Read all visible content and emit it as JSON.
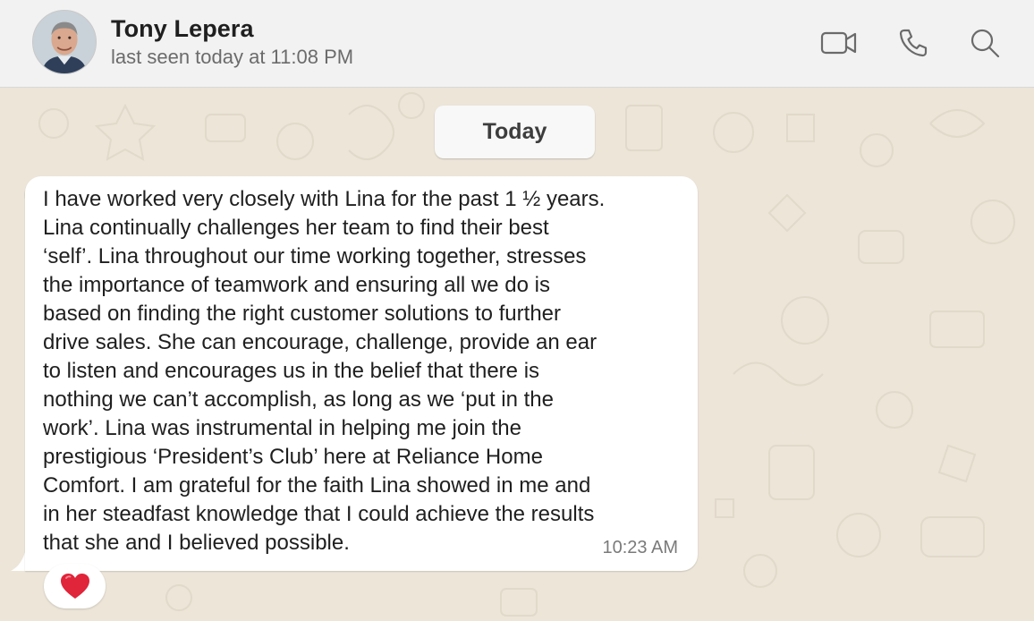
{
  "header": {
    "contact_name": "Tony Lepera",
    "last_seen": "last seen today at 11:08 PM",
    "icons": [
      "video-call-icon",
      "voice-call-icon",
      "search-icon"
    ]
  },
  "chat": {
    "date_separator": "Today",
    "messages": [
      {
        "direction": "incoming",
        "text": "I have worked very closely with Lina for the past 1 ½ years.\nLina continually challenges her team to find their best\n‘self’. Lina throughout our time working together, stresses\nthe importance of teamwork and ensuring all we do is\nbased on finding the right customer solutions to further\ndrive sales. She can encourage, challenge, provide an ear\nto listen and encourages us in the belief that there is\nnothing we can’t accomplish, as long as we ‘put in the\nwork’. Lina was instrumental in helping me join the\nprestigious ‘President’s Club’ here at Reliance Home\nComfort. I am grateful for the faith Lina showed in me and\nin her steadfast knowledge that I could achieve the results\nthat she and I believed possible.",
        "time": "10:23 AM",
        "reaction": "heart-icon"
      }
    ]
  },
  "colors": {
    "header_bg": "#f2f2f2",
    "chat_bg": "#ece5d8",
    "bubble_bg": "#ffffff",
    "reaction_heart": "#e0243a"
  }
}
